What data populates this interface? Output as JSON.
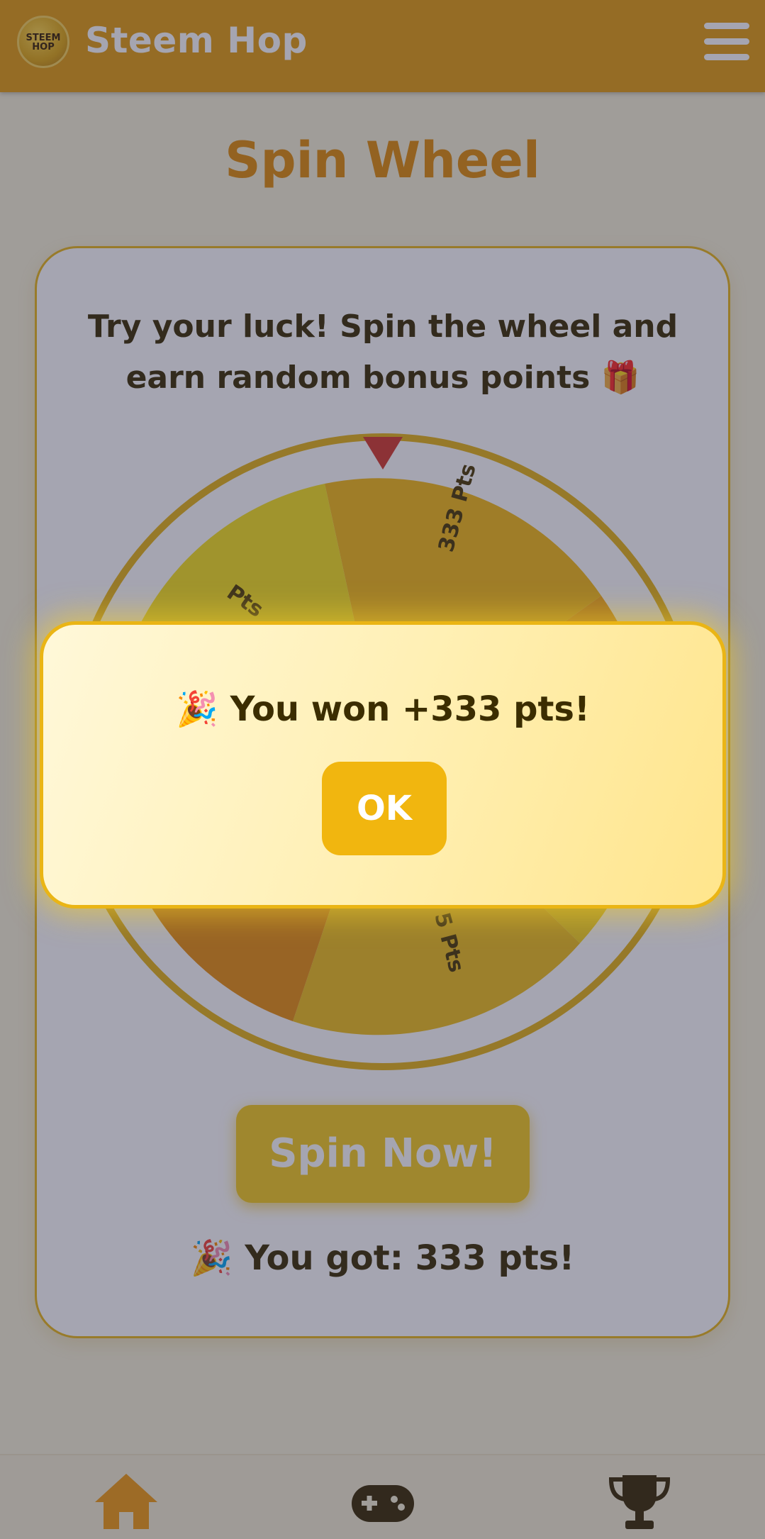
{
  "header": {
    "logo_text": "STEEM HOP",
    "app_title": "Steem Hop"
  },
  "page": {
    "title": "Spin Wheel",
    "description": "Try your luck! Spin the wheel and earn random bonus points 🎁"
  },
  "wheel": {
    "visible_labels": [
      "333 Pts",
      "Pts",
      "5 Pts"
    ],
    "colors": {
      "segment_light": "#f7d51c",
      "segment_gold": "#f5bb14",
      "segment_orange": "#f5a512",
      "segment_deep": "#e88f0f",
      "rim": "#e6b416",
      "pointer": "#d53a2c"
    }
  },
  "spin_button": {
    "label": "Spin Now!"
  },
  "result": {
    "text": "🎉 You got: 333 pts!"
  },
  "modal": {
    "message": "🎉 You won +333 pts!",
    "ok_label": "OK"
  },
  "nav": {
    "items": [
      {
        "icon": "home-icon"
      },
      {
        "icon": "gamepad-icon"
      },
      {
        "icon": "trophy-icon"
      }
    ]
  },
  "colors": {
    "header_bg": "#e49d0e",
    "accent": "#f1b60f",
    "title_orange": "#e08c08",
    "text_dark": "#3b2d00"
  }
}
